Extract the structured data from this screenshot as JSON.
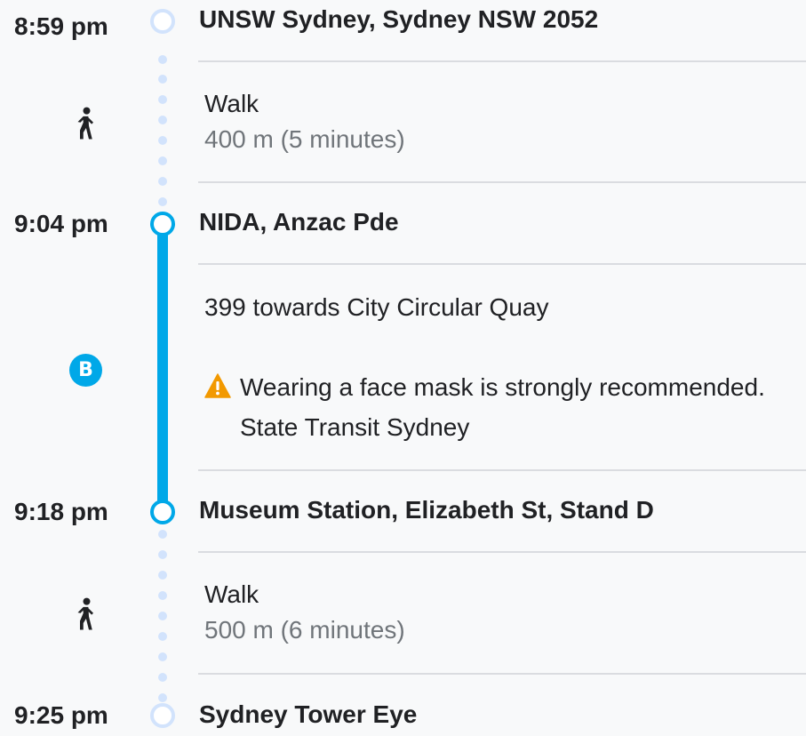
{
  "colors": {
    "route_blue": "#00a8e8",
    "walk_dot": "#d2e3fc",
    "warning": "#f29900",
    "muted_text": "#70757a",
    "divider": "#dadce0"
  },
  "stops": [
    {
      "time": "8:59 pm",
      "name": "UNSW Sydney, Sydney NSW 2052"
    },
    {
      "time": "9:04 pm",
      "name": "NIDA, Anzac Pde"
    },
    {
      "time": "9:18 pm",
      "name": "Museum Station, Elizabeth St, Stand D"
    },
    {
      "time": "9:25 pm",
      "name": "Sydney Tower Eye"
    }
  ],
  "segments": [
    {
      "mode_icon": "walk-icon",
      "label": "Walk",
      "detail": "400 m (5 minutes)"
    },
    {
      "mode_icon": "bus-icon",
      "badge": "B",
      "route": "399 towards City Circular Quay",
      "alert_icon": "warning-icon",
      "alert_text": "Wearing a face mask is strongly recommended.",
      "operator": "State Transit Sydney"
    },
    {
      "mode_icon": "walk-icon",
      "label": "Walk",
      "detail": "500 m (6 minutes)"
    }
  ]
}
